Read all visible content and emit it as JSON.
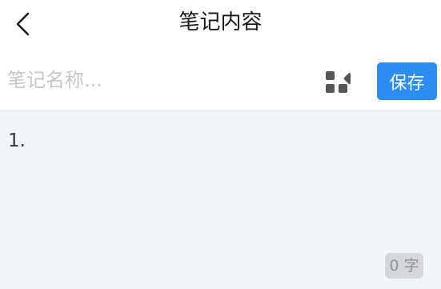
{
  "header": {
    "title": "笔记内容",
    "back_icon": "chevron-left-icon"
  },
  "name_row": {
    "placeholder": "笔记名称...",
    "value": "",
    "grid_icon": "apps-grid-icon",
    "save_label": "保存"
  },
  "editor": {
    "content": "1.",
    "char_count": "0 字"
  },
  "colors": {
    "accent": "#2d8cf0",
    "editor_bg": "#f3f6f9",
    "badge_bg": "#d5d7da",
    "icon": "#555555"
  }
}
